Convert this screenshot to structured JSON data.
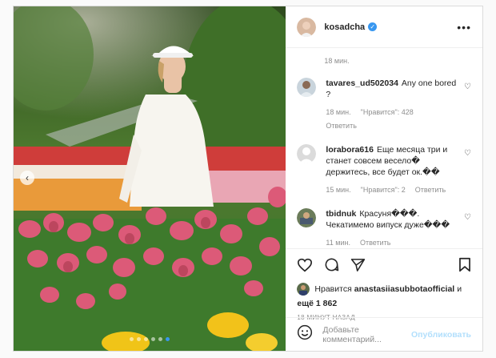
{
  "post": {
    "author": "kosadcha",
    "more_label": "•••",
    "caption_time": "18 мин.",
    "posted_ago": "18 МИНУТ НАЗАД",
    "carousel": {
      "dots": 6,
      "active_index": 5
    }
  },
  "comments": [
    {
      "user": "tavares_ud502034",
      "text": "Any one bored ?",
      "time": "18 мин.",
      "likes": "\"Нравится\": 428",
      "reply": "Ответить"
    },
    {
      "user": "lorabora616",
      "text": "Еще месяца три и станет совсем весело� держитесь, все будет ок.��",
      "time": "15 мин.",
      "likes": "\"Нравится\": 2",
      "reply": "Ответить"
    },
    {
      "user": "tbidnuk",
      "text": "Красуня���. Чекатимемо випуск дуже���",
      "time": "11 мин.",
      "likes": "",
      "reply": "Ответить"
    }
  ],
  "likes": {
    "prefix": "Нравится",
    "user": "anastasiiasubbotaofficial",
    "suffix": "и",
    "others": "ещё 1 862"
  },
  "add_comment": {
    "placeholder": "Добавьте комментарий...",
    "post_label": "Опубликовать"
  },
  "colors": {
    "accent": "#3897f0",
    "muted": "#8e8e8e",
    "post_disabled": "#b2dffc"
  },
  "icons": [
    "like-icon",
    "comment-icon",
    "share-icon",
    "save-icon",
    "emoji-icon",
    "verified-badge-icon",
    "more-options-icon"
  ]
}
